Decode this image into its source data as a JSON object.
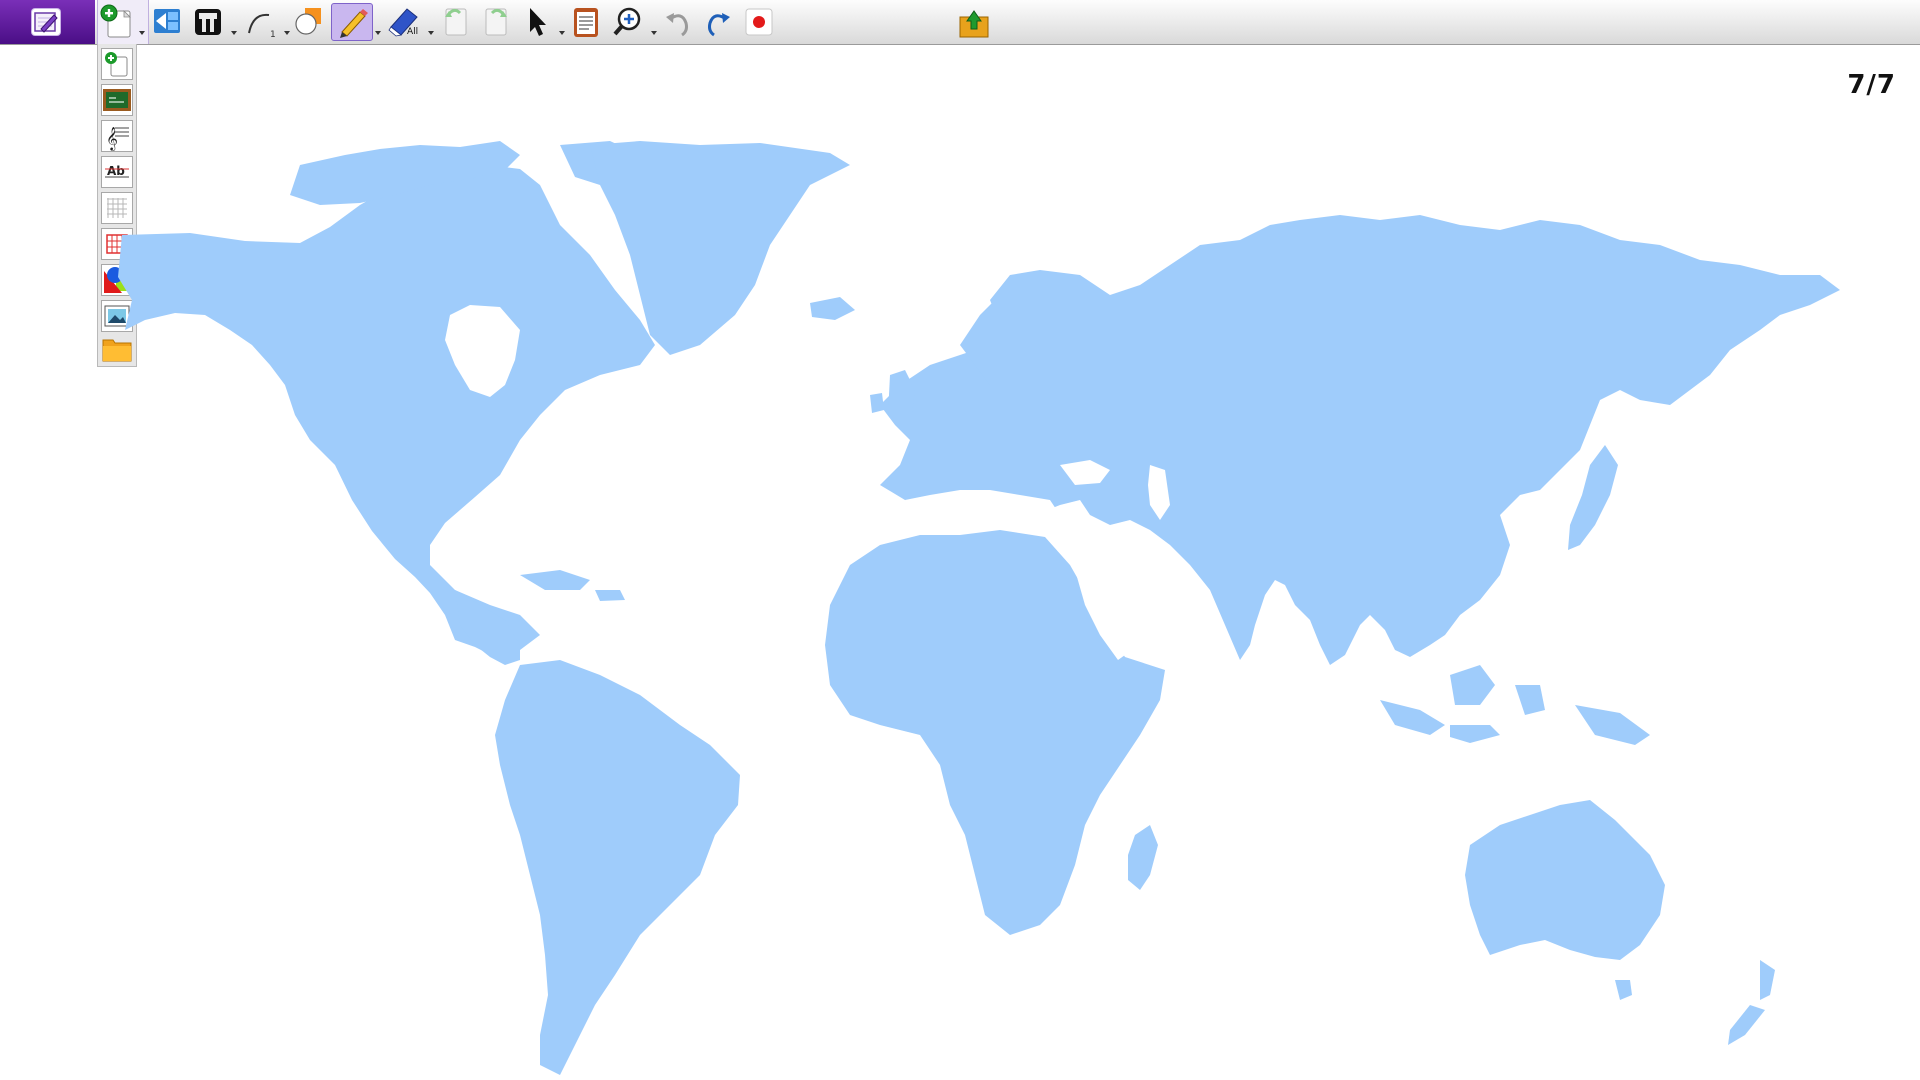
{
  "toolbar": {
    "tools": [
      {
        "name": "new-page",
        "icon": "new-page-icon"
      },
      {
        "name": "background",
        "icon": "background-icon"
      },
      {
        "name": "ink-stamp",
        "icon": "stamp-icon"
      },
      {
        "name": "line",
        "icon": "line-icon"
      },
      {
        "name": "shape",
        "icon": "shape-icon"
      },
      {
        "name": "pen",
        "icon": "pen-icon",
        "active": true
      },
      {
        "name": "eraser",
        "icon": "eraser-icon",
        "label": "All"
      },
      {
        "name": "previous-page",
        "icon": "page-back-icon"
      },
      {
        "name": "next-page",
        "icon": "page-forward-icon"
      },
      {
        "name": "select",
        "icon": "cursor-icon"
      },
      {
        "name": "page-list",
        "icon": "clipboard-icon"
      },
      {
        "name": "zoom",
        "icon": "zoom-icon"
      },
      {
        "name": "undo",
        "icon": "undo-icon"
      },
      {
        "name": "redo",
        "icon": "redo-icon"
      },
      {
        "name": "record",
        "icon": "record-icon"
      },
      {
        "name": "save",
        "icon": "save-icon"
      }
    ],
    "eraser_label": "All"
  },
  "page_menu": {
    "items": [
      "blank-page-icon",
      "chalkboard-page-icon",
      "music-staff-page-icon",
      "handwriting-lines-page-icon",
      "grid-page-icon",
      "red-grid-page-icon",
      "shapes-page-icon",
      "image-page-icon",
      "folder-icon"
    ]
  },
  "page_counter": {
    "text": "7/7"
  },
  "canvas": {
    "content": "world-map",
    "map_color": "#9fccfb"
  },
  "colors": {
    "accent": "#5b1a9b",
    "active_tool_bg": "#c9b7ef",
    "map_land": "#9fccfb"
  }
}
